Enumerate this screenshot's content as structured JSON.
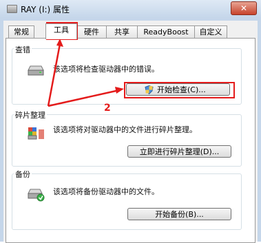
{
  "window": {
    "title": "RAY (I:) 属性",
    "close_glyph": "✕"
  },
  "tabs": [
    {
      "label": "常规"
    },
    {
      "label": "工具"
    },
    {
      "label": "硬件"
    },
    {
      "label": "共享"
    },
    {
      "label": "ReadyBoost"
    },
    {
      "label": "自定义"
    }
  ],
  "active_tab": "工具",
  "groups": {
    "error_check": {
      "title": "查错",
      "desc": "该选项将检查驱动器中的错误。",
      "button": "开始检查(C)..."
    },
    "defrag": {
      "title": "碎片整理",
      "desc": "该选项将对驱动器中的文件进行碎片整理。",
      "button": "立即进行碎片整理(D)..."
    },
    "backup": {
      "title": "备份",
      "desc": "该选项将备份驱动器中的文件。",
      "button": "开始备份(B)..."
    }
  },
  "annotations": {
    "step2": "2"
  },
  "colors": {
    "annotation_red": "#e41b1b",
    "frame_blue": "#c5d6ea"
  }
}
